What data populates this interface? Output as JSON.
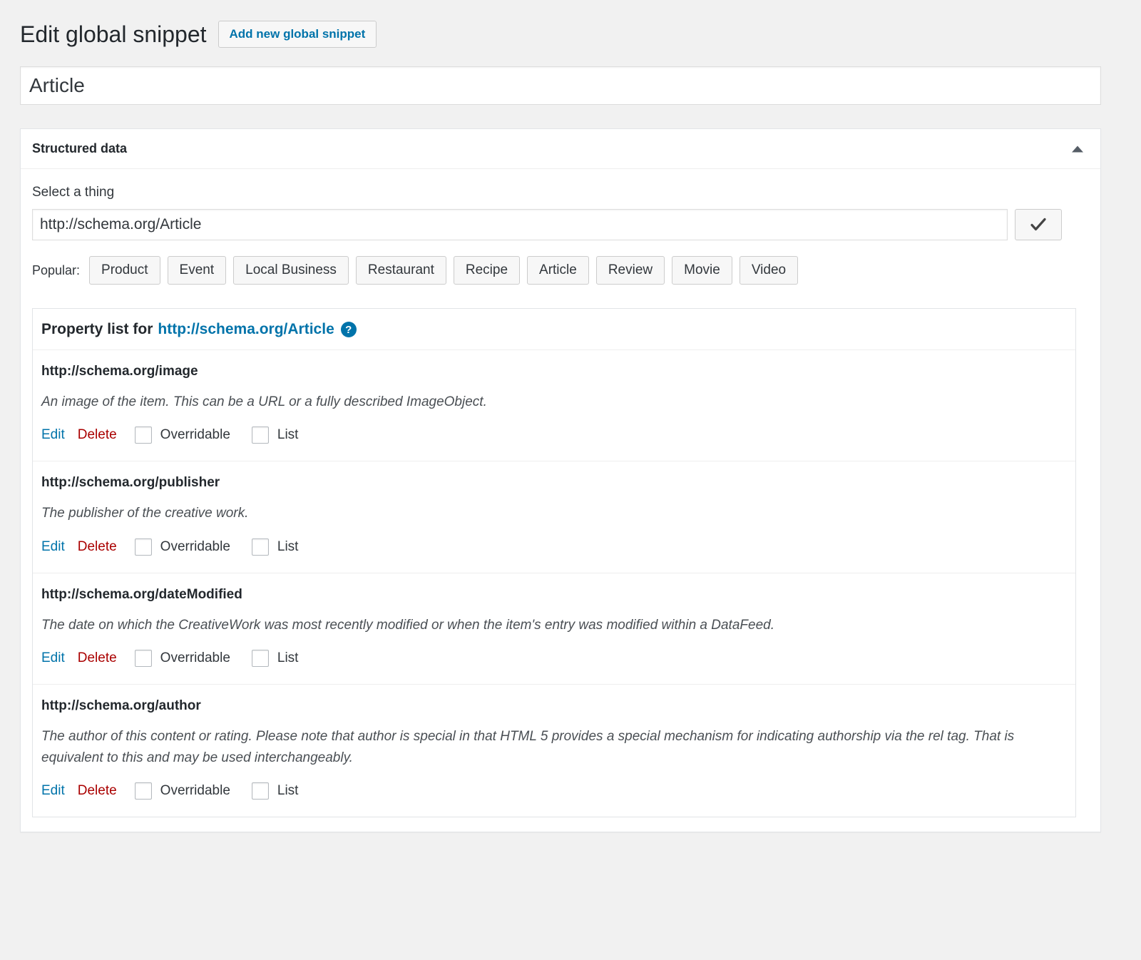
{
  "header": {
    "title": "Edit global snippet",
    "add_button_label": "Add new global snippet"
  },
  "snippet_title": {
    "value": "Article",
    "placeholder": "Enter title here"
  },
  "metabox": {
    "heading": "Structured data",
    "toggle_icon": "triangle-up-icon"
  },
  "select_thing": {
    "label": "Select a thing",
    "value": "http://schema.org/Article",
    "placeholder": "http://schema.org/Thing",
    "confirm_icon": "checkmark-icon"
  },
  "popular": {
    "label": "Popular:",
    "items": [
      "Product",
      "Event",
      "Local Business",
      "Restaurant",
      "Recipe",
      "Article",
      "Review",
      "Movie",
      "Video"
    ]
  },
  "property_list": {
    "heading_prefix": "Property list for",
    "thing_url": "http://schema.org/Article",
    "help_icon_glyph": "?",
    "actions": {
      "edit": "Edit",
      "delete": "Delete",
      "overridable": "Overridable",
      "list": "List"
    },
    "properties": [
      {
        "name": "http://schema.org/image",
        "description": "An image of the item. This can be a URL or a fully described ImageObject.",
        "overridable": false,
        "list": false
      },
      {
        "name": "http://schema.org/publisher",
        "description": "The publisher of the creative work.",
        "overridable": false,
        "list": false
      },
      {
        "name": "http://schema.org/dateModified",
        "description": "The date on which the CreativeWork was most recently modified or when the item's entry was modified within a DataFeed.",
        "overridable": false,
        "list": false
      },
      {
        "name": "http://schema.org/author",
        "description": "The author of this content or rating. Please note that author is special in that HTML 5 provides a special mechanism for indicating authorship via the rel tag. That is equivalent to this and may be used interchangeably.",
        "overridable": false,
        "list": false
      }
    ]
  },
  "colors": {
    "page_background": "#f1f1f1",
    "panel_background": "#ffffff",
    "link": "#0073aa",
    "delete": "#aa0000",
    "text": "#32373c",
    "border": "#e2e4e7"
  }
}
